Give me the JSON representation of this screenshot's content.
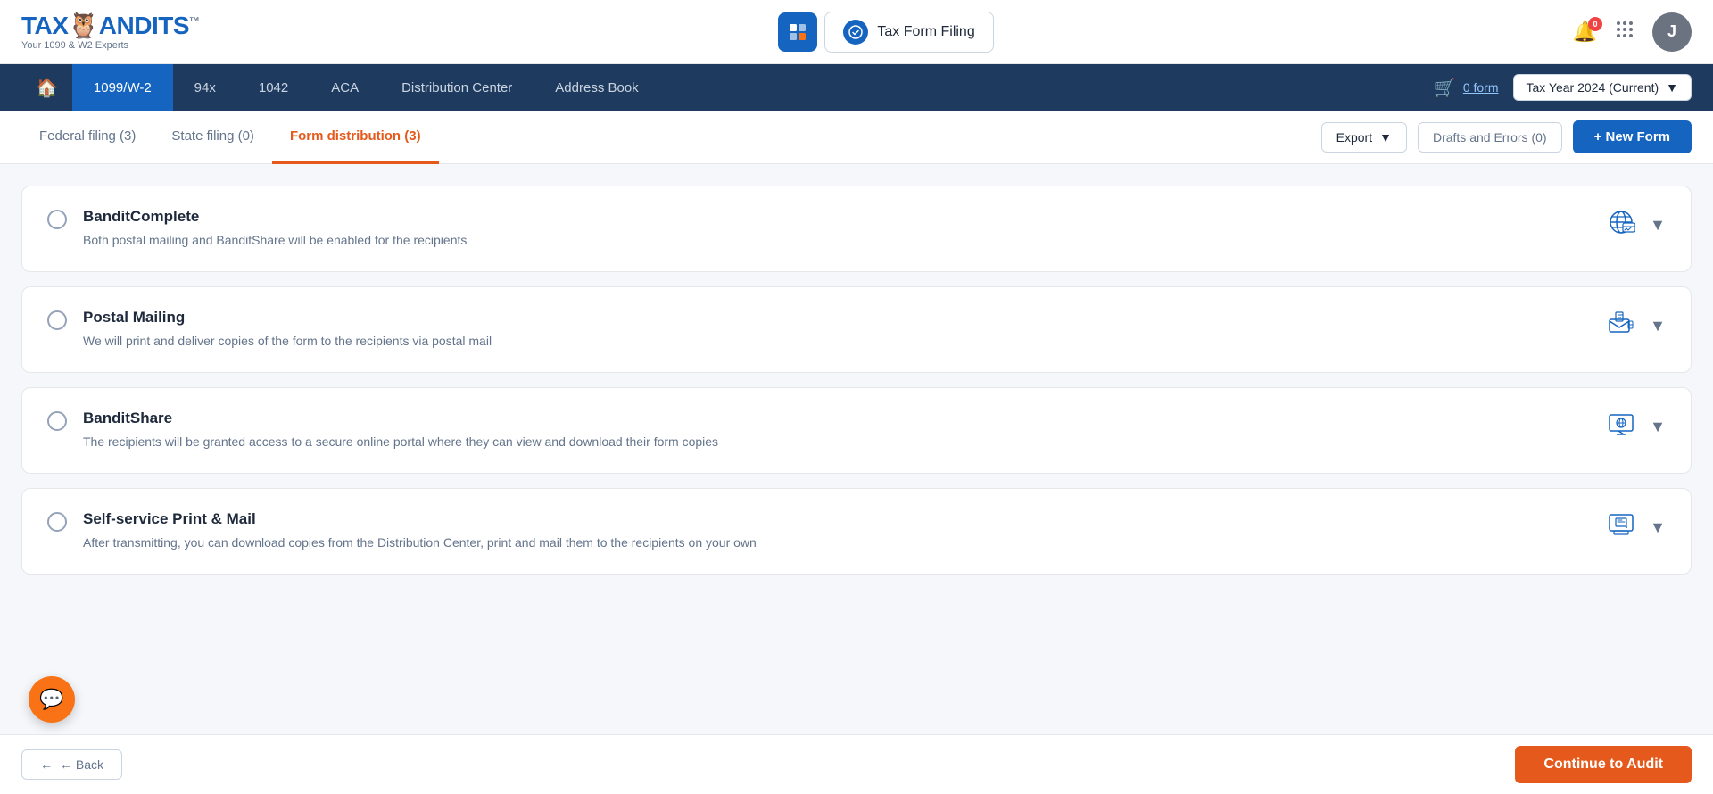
{
  "logo": {
    "main": "TAX",
    "owl": "🦉",
    "brand": "ANDITS",
    "trademark": "™",
    "sub": "Your 1099 & W2 Experts"
  },
  "header": {
    "grid_icon": "⊞",
    "tax_form_btn": "Tax Form Filing",
    "notification_badge": "0",
    "apps_icon": "⠿",
    "avatar_letter": "J"
  },
  "nav": {
    "home_icon": "🏠",
    "items": [
      {
        "label": "1099/W-2",
        "active": true
      },
      {
        "label": "94x",
        "active": false
      },
      {
        "label": "1042",
        "active": false
      },
      {
        "label": "ACA",
        "active": false
      },
      {
        "label": "Distribution Center",
        "active": false
      },
      {
        "label": "Address Book",
        "active": false
      }
    ],
    "cart_label": "0 form",
    "tax_year": "Tax Year 2024 (Current)"
  },
  "tabs": {
    "items": [
      {
        "label": "Federal filing (3)",
        "active": false
      },
      {
        "label": "State filing (0)",
        "active": false
      },
      {
        "label": "Form distribution (3)",
        "active": true
      }
    ],
    "export_label": "Export",
    "drafts_label": "Drafts and Errors (0)",
    "new_form_label": "+ New  Form"
  },
  "distribution_options": [
    {
      "title": "BanditComplete",
      "description": "Both postal mailing and BanditShare will be enabled for the recipients",
      "icon_type": "globe-mail"
    },
    {
      "title": "Postal Mailing",
      "description": "We will print and deliver copies of the form to the recipients via postal mail",
      "icon_type": "mailbox"
    },
    {
      "title": "BanditShare",
      "description": "The recipients will be granted access to a secure online portal where they can view and download their form copies",
      "icon_type": "globe-monitor"
    },
    {
      "title": "Self-service Print & Mail",
      "description": "After transmitting, you can download copies from the Distribution Center, print and mail them to the recipients on your own",
      "icon_type": "printer"
    }
  ],
  "footer": {
    "back_label": "← Back",
    "continue_label": "Continue to Audit"
  }
}
